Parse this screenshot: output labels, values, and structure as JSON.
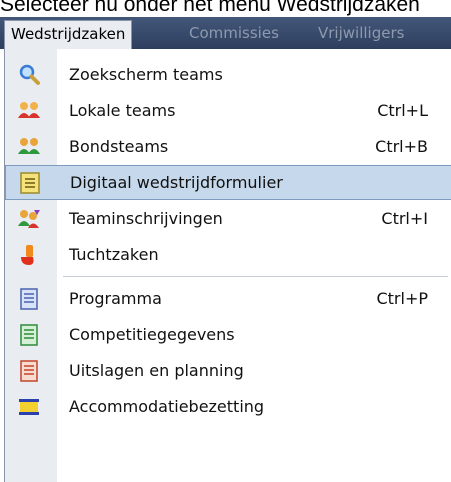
{
  "caption": "Selecteer nu onder het menu Wedstrijdzaken",
  "menubar": {
    "items": [
      {
        "label": "Wedstrijdzaken"
      },
      {
        "label": "Commissies"
      },
      {
        "label": "Vrijwilligers"
      }
    ]
  },
  "menu": {
    "items": [
      {
        "label": "Zoekscherm teams",
        "shortcut": "",
        "icon": "magnifier-icon"
      },
      {
        "label": "Lokale teams",
        "shortcut": "Ctrl+L",
        "icon": "team-red-icon"
      },
      {
        "label": "Bondsteams",
        "shortcut": "Ctrl+B",
        "icon": "team-green-icon"
      },
      {
        "label": "Digitaal wedstrijdformulier",
        "shortcut": "",
        "icon": "form-yellow-icon",
        "highlighted": true
      },
      {
        "label": "Teaminschrijvingen",
        "shortcut": "Ctrl+I",
        "icon": "team-register-icon"
      },
      {
        "label": "Tuchtzaken",
        "shortcut": "",
        "icon": "whistle-icon"
      },
      {
        "label": "Programma",
        "shortcut": "Ctrl+P",
        "icon": "document-blue-icon"
      },
      {
        "label": "Competitiegegevens",
        "shortcut": "",
        "icon": "document-green-icon"
      },
      {
        "label": "Uitslagen en planning",
        "shortcut": "",
        "icon": "document-red-icon"
      },
      {
        "label": "Accommodatiebezetting",
        "shortcut": "",
        "icon": "calendar-icon"
      }
    ]
  },
  "colors": {
    "menubar": "#3a4c6c",
    "highlight": "#c6d8ec",
    "gutter": "#e9ecf1"
  }
}
